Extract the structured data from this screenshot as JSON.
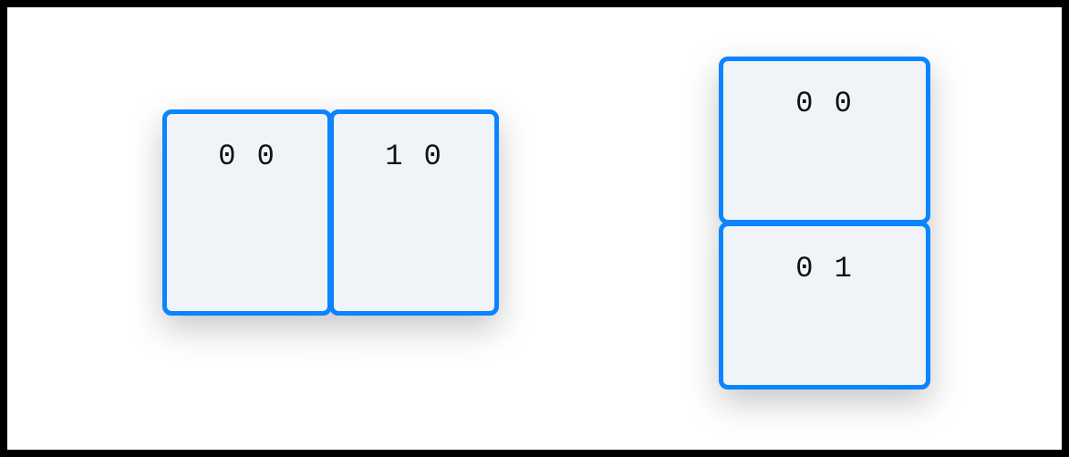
{
  "groups": [
    {
      "orientation": "horizontal",
      "boxes": [
        {
          "label": "0 0"
        },
        {
          "label": "1 0"
        }
      ]
    },
    {
      "orientation": "vertical",
      "boxes": [
        {
          "label": "0 0"
        },
        {
          "label": "0 1"
        }
      ]
    }
  ]
}
